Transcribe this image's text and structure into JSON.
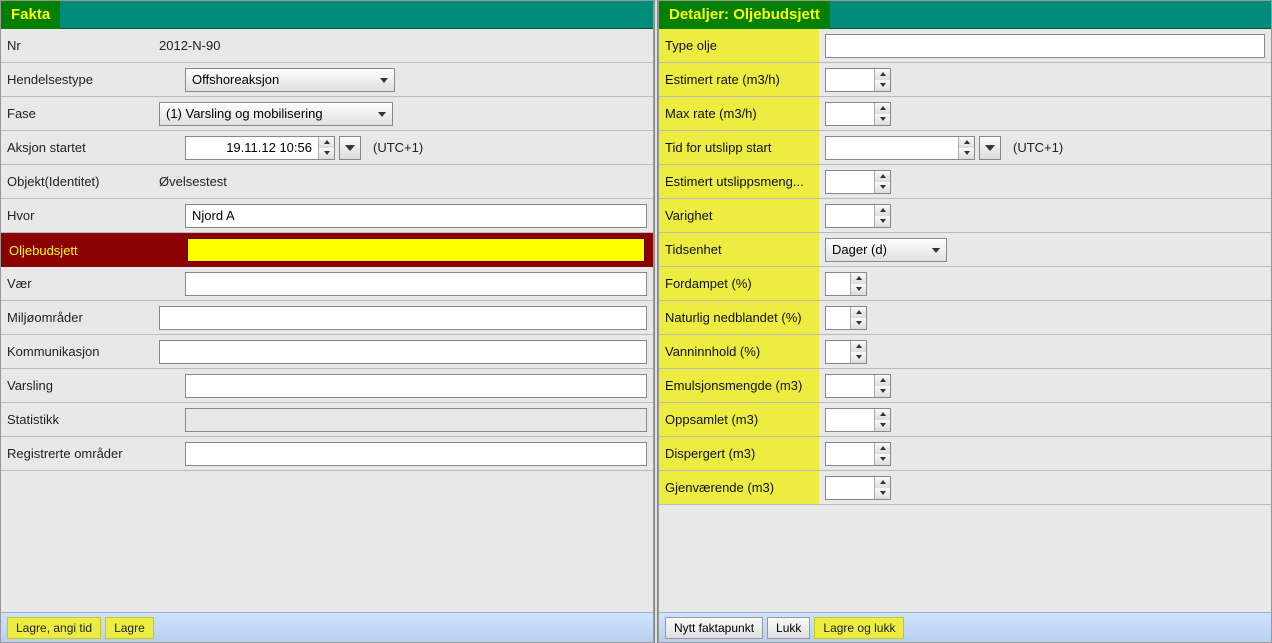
{
  "left": {
    "title": "Fakta",
    "rows": {
      "nr": {
        "label": "Nr",
        "value": "2012-N-90"
      },
      "hendelsestype": {
        "label": "Hendelsestype",
        "value": "Offshoreaksjon"
      },
      "fase": {
        "label": "Fase",
        "value": "(1) Varsling og mobilisering"
      },
      "aksjon_startet": {
        "label": "Aksjon startet",
        "value": "19.11.12 10:56",
        "tz": "(UTC+1)"
      },
      "objekt": {
        "label": "Objekt(Identitet)",
        "value": "Øvelsestest"
      },
      "hvor": {
        "label": "Hvor",
        "value": "Njord A"
      },
      "oljebudsjett": {
        "label": "Oljebudsjett",
        "value": ""
      },
      "vaer": {
        "label": "Vær",
        "value": ""
      },
      "miljoomrader": {
        "label": "Miljøområder",
        "value": ""
      },
      "kommunikasjon": {
        "label": "Kommunikasjon",
        "value": ""
      },
      "varsling": {
        "label": "Varsling",
        "value": ""
      },
      "statistikk": {
        "label": "Statistikk",
        "value": ""
      },
      "registrerte": {
        "label": "Registrerte områder",
        "value": ""
      }
    },
    "footer": {
      "lagre_angi_tid": "Lagre, angi tid",
      "lagre": "Lagre"
    }
  },
  "right": {
    "title": "Detaljer: Oljebudsjett",
    "rows": {
      "type_olje": {
        "label": "Type olje",
        "value": ""
      },
      "estimert_rate": {
        "label": "Estimert rate (m3/h)",
        "value": ""
      },
      "max_rate": {
        "label": "Max rate (m3/h)",
        "value": ""
      },
      "tid_utslipp": {
        "label": "Tid for utslipp start",
        "value": "",
        "tz": "(UTC+1)"
      },
      "estimert_mengde": {
        "label": "Estimert utslippsmeng...",
        "value": ""
      },
      "varighet": {
        "label": "Varighet",
        "value": ""
      },
      "tidsenhet": {
        "label": "Tidsenhet",
        "value": "Dager (d)"
      },
      "fordampet": {
        "label": "Fordampet (%)",
        "value": ""
      },
      "naturlig": {
        "label": "Naturlig nedblandet (%)",
        "value": ""
      },
      "vanninnhold": {
        "label": "Vanninnhold (%)",
        "value": ""
      },
      "emulsjon": {
        "label": "Emulsjonsmengde (m3)",
        "value": ""
      },
      "oppsamlet": {
        "label": "Oppsamlet (m3)",
        "value": ""
      },
      "dispergert": {
        "label": "Dispergert (m3)",
        "value": ""
      },
      "gjenvaerende": {
        "label": "Gjenværende (m3)",
        "value": ""
      }
    },
    "footer": {
      "nytt_faktapunkt": "Nytt faktapunkt",
      "lukk": "Lukk",
      "lagre_og_lukk": "Lagre og lukk"
    }
  }
}
